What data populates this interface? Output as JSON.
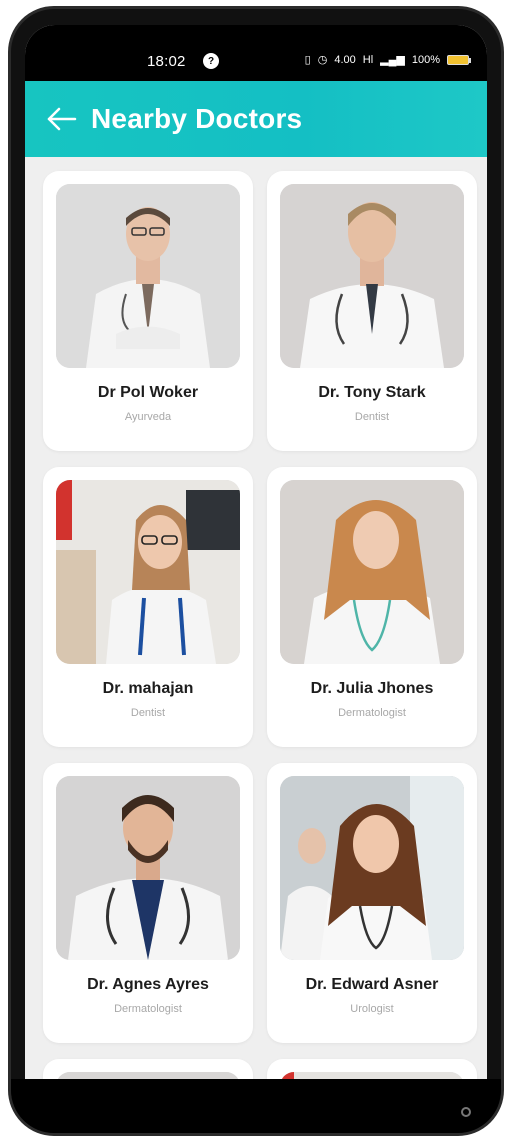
{
  "status": {
    "time": "18:02",
    "notification_badge": "?",
    "network_speed": "4.00",
    "signal": "Hl",
    "battery": "100%"
  },
  "app_bar": {
    "title": "Nearby Doctors"
  },
  "doctors": [
    {
      "name": "Dr Pol Woker",
      "specialty": "Ayurveda"
    },
    {
      "name": "Dr. Tony Stark",
      "specialty": "Dentist"
    },
    {
      "name": "Dr. mahajan",
      "specialty": "Dentist"
    },
    {
      "name": "Dr. Julia Jhones",
      "specialty": "Dermatologist"
    },
    {
      "name": "Dr. Agnes Ayres",
      "specialty": "Dermatologist"
    },
    {
      "name": "Dr. Edward Asner",
      "specialty": "Urologist"
    }
  ],
  "colors": {
    "accent": "#17c5c1",
    "background": "#efefef",
    "card": "#ffffff",
    "title_text": "#ffffff",
    "name_text": "#1d1d1d",
    "specialty_text": "#a8a8a8"
  },
  "icons": {
    "back": "arrow-left-icon"
  }
}
